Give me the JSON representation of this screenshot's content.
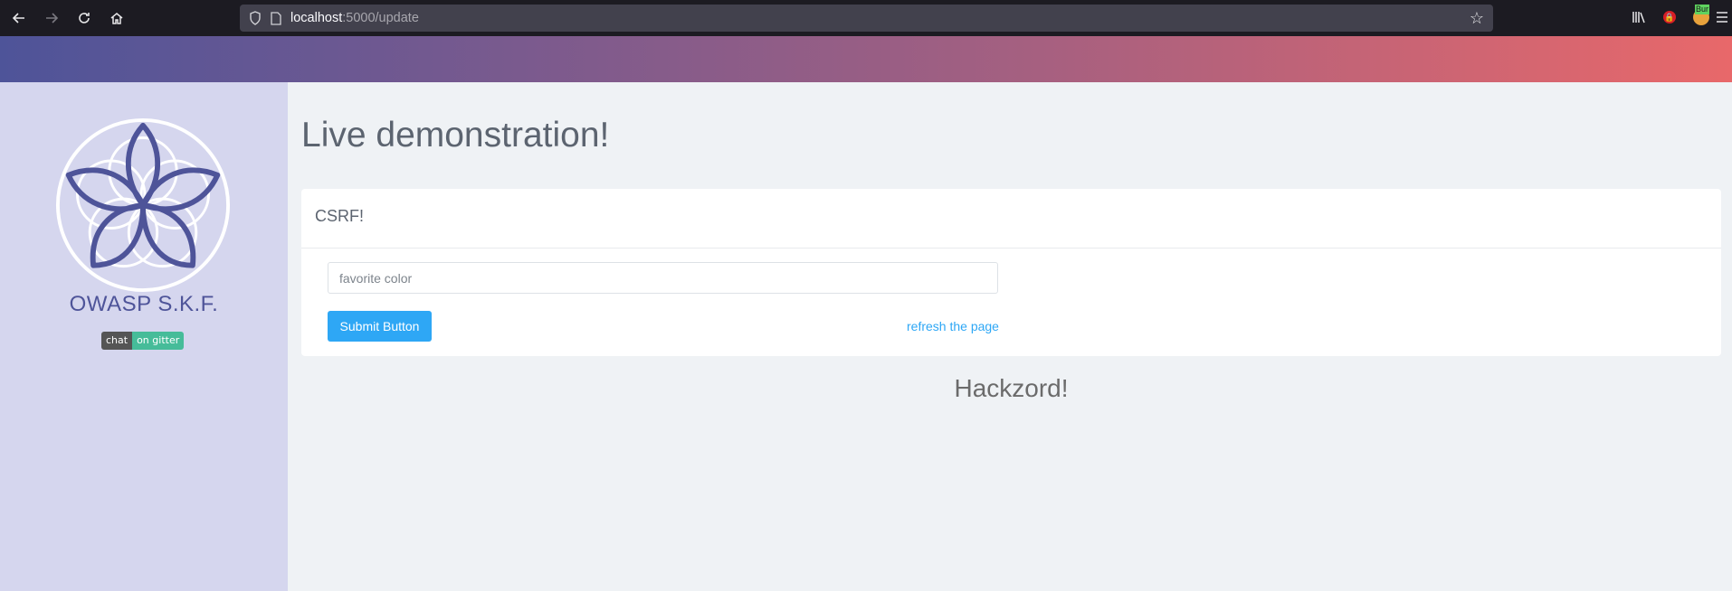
{
  "browser": {
    "url_host": "localhost",
    "url_path": ":5000/update",
    "icons": {
      "back": "arrow-left-icon",
      "forward": "arrow-right-icon",
      "reload": "reload-icon",
      "home": "home-icon",
      "shield": "shield-icon",
      "page": "page-icon",
      "bookmark": "star-icon",
      "library": "library-icon",
      "extension_red": "lock-extension-icon",
      "extension_burp": "burp-extension-icon",
      "menu": "hamburger-menu-icon"
    },
    "burp_label": "Bur"
  },
  "header": {
    "gradient_start": "#4e5499",
    "gradient_end": "#e8686a"
  },
  "sidebar": {
    "brand": "OWASP S.K.F.",
    "badge_left": "chat",
    "badge_right": "on gitter",
    "logo_color": "#4e5499"
  },
  "main": {
    "title": "Live demonstration!",
    "card_title": "CSRF!",
    "input_placeholder": "favorite color",
    "submit_label": "Submit Button",
    "refresh_label": "refresh the page",
    "footer": "Hackzord!"
  },
  "colors": {
    "accent": "#2ea7f5",
    "sidebar_bg": "#d5d6ee",
    "page_bg": "#eff2f5"
  }
}
